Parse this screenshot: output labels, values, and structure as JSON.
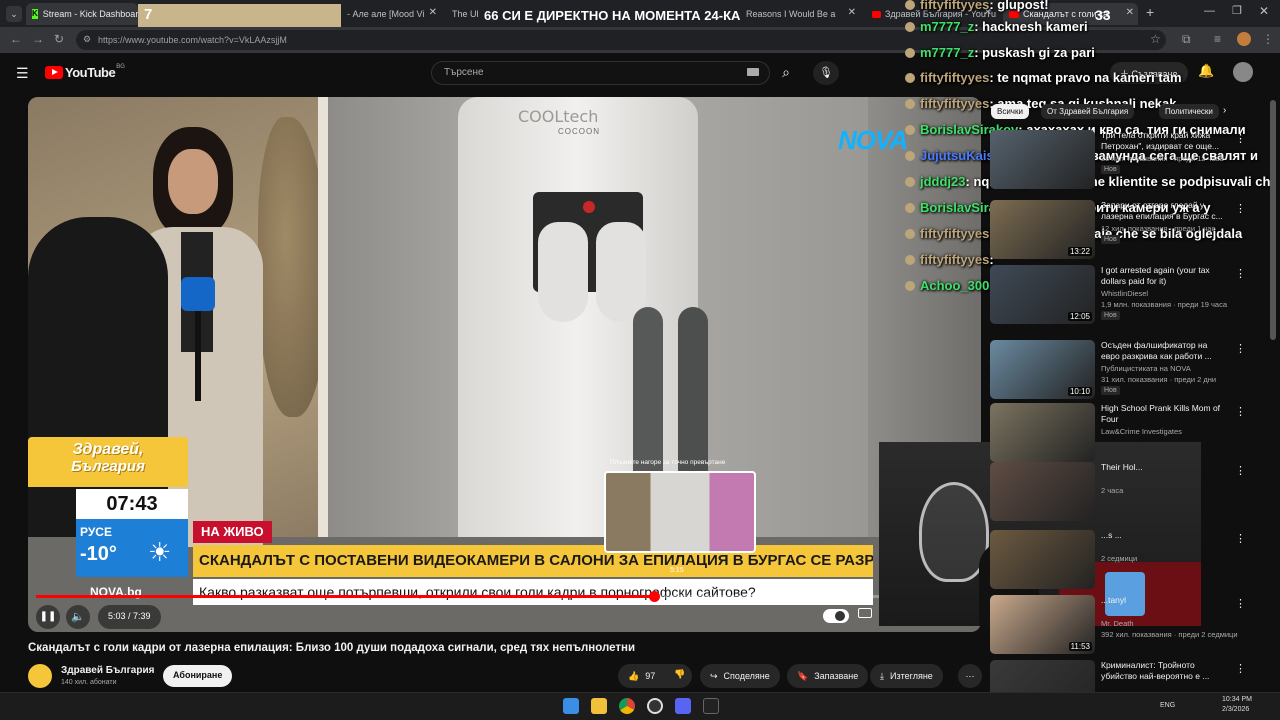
{
  "browser": {
    "tabs": [
      {
        "label": "Stream - Kick Dashboard"
      },
      {
        "label": "- Але але [Mood Vi"
      },
      {
        "label": "The Ul"
      },
      {
        "label": "Reasons I Would Be a"
      },
      {
        "label": "Здравей България - YouTu"
      },
      {
        "label": "Скандалът с голи ка"
      }
    ],
    "url": "https://www.youtube.com/watch?v=VkLAAzsjjM"
  },
  "stream_overlay": {
    "counter_left": "7",
    "headline": "66 СИ Е ДИРЕКТНО НА МОМЕНТА 24-КА",
    "counter_right": "33"
  },
  "youtube": {
    "logo_text": "YouTube",
    "region": "BG",
    "search_placeholder": "Търсене",
    "create_label": "Създаване",
    "video": {
      "title": "Скандалът с голи кадри от лазерна епилация: Близо 100 души подадоха сигнали, сред тях непълнолетни",
      "time": "5:03 / 7:39",
      "progress": 0.66,
      "hover_time": "5:15",
      "hover_hint": "Плъзнете нагоре за точно превъртане",
      "channel_name": "Здравей България",
      "subscribers": "140 хил. абонати",
      "subscribe_label": "Абониране",
      "likes": "97",
      "share_label": "Споделяне",
      "save_label": "Запазване",
      "download_label": "Изтегляне"
    },
    "tv_overlay": {
      "show_name_1": "Здравей,",
      "show_name_2": "България",
      "clock": "07:43",
      "city": "РУСЕ",
      "temperature": "-10°",
      "live": "НА ЖИВО",
      "headline": "СКАНДАЛЪТ С ПОСТАВЕНИ ВИДЕОКАМЕРИ В САЛОНИ ЗА ЕПИЛАЦИЯ В БУРГАС СЕ РАЗРАСТВА",
      "subhead": "Какво разказват още потърпевши, открили свои голи кадри в порнографски сайтове?",
      "channel_logo": "NOVA",
      "site": "NOVA.bg",
      "device_brand": "COOLtech",
      "device_brand_2": "COCOON"
    },
    "filter_chips": [
      "Всички",
      "От Здравей България",
      "Политически"
    ],
    "sidebar": [
      {
        "title": "Три тела открити край хижа Петрохан\", издирват се още...",
        "channel": "",
        "meta": "28 хил. показвания · преди 12 часа",
        "duration": "",
        "badge": "Нов"
      },
      {
        "title": "Запари от отгоре гледай у лазерна епилация в Бургас с...",
        "channel": "",
        "meta": "12 хил. показвания · преди 1 час",
        "duration": "13:22",
        "badge": "Нов"
      },
      {
        "title": "I got arrested again (your tax dollars paid for it)",
        "channel": "WhistlinDiesel",
        "meta": "1,9 млн. показвания · преди 19 часа",
        "duration": "12:05",
        "badge": "Нов"
      },
      {
        "title": "Осъден фалшификатор на евро разкрива как работи ...",
        "channel": "Публицистиката на NOVA",
        "meta": "31 хил. показвания · преди 2 дни",
        "duration": "10:10",
        "badge": "Нов"
      },
      {
        "title": "High School Prank Kills Mom of Four",
        "channel": "Law&Crime Investigates",
        "meta": "",
        "duration": "",
        "badge": ""
      },
      {
        "title": "Their Hol...",
        "channel": "",
        "meta": "2 часа",
        "duration": "",
        "badge": ""
      },
      {
        "title": "...s ...",
        "channel": "",
        "meta": "2 седмици",
        "duration": "",
        "badge": ""
      },
      {
        "title": "...tanyl",
        "channel": "Mr. Death",
        "meta": "392 хил. показвания · преди 2 седмици",
        "duration": "11:53",
        "badge": ""
      },
      {
        "title": "Криминалист: Тройното убийство най-вероятно е ...",
        "channel": "",
        "meta": "",
        "duration": "",
        "badge": ""
      }
    ]
  },
  "chat": [
    {
      "user": "fiftyfiftyyes",
      "text": ": glupost!",
      "color": "#bda57a"
    },
    {
      "user": "m7777_z",
      "text": ": hacknesh kameri",
      "color": "#3fe06a"
    },
    {
      "user": "m7777_z",
      "text": ": puskash gi za pari",
      "color": "#3fe06a"
    },
    {
      "user": "fiftyfiftyyes",
      "text": ": te nqmat pravo na kameri tam",
      "color": "#bda57a"
    },
    {
      "user": "fiftyfiftyyes",
      "text": ": ama teq sa gi kushnali nekak",
      "color": "#bda57a"
    },
    {
      "user": "BorislavSirakov",
      "text": ": ахахахах и кво са. тия ги снимали",
      "color": "#3fe06a"
    },
    {
      "user": "JujutsuKaisen",
      "text": ": ей свалиха замунда сега ще свалят и",
      "color": "#4a7bff"
    },
    {
      "user": "jdddj23",
      "text": ": nqkade pisheshe che klientite se podpisuvali ch",
      "color": "#3fe06a"
    },
    {
      "user": "BorislavSirakov",
      "text": ": Е били скрити камери уж а у",
      "color": "#3fe06a"
    },
    {
      "user": "fiftyfiftyyes",
      "text": ": ednata sa she kaje che se bila oglejdala",
      "color": "#bda57a"
    },
    {
      "user": "fiftyfiftyyes",
      "text": ": ",
      "color": "#bda57a"
    },
    {
      "user": "Achoo_3006",
      "text": ": ХАХАХАХА",
      "color": "#3fe06a"
    }
  ],
  "taskbar": {
    "lang": "ENG",
    "time": "10:34 PM",
    "date": "2/3/2026"
  },
  "colors": {
    "accent_red": "#ff0000",
    "tv_yellow": "#f5c53a",
    "tv_blue": "#1e7fd6",
    "live_red": "#c8102e"
  }
}
